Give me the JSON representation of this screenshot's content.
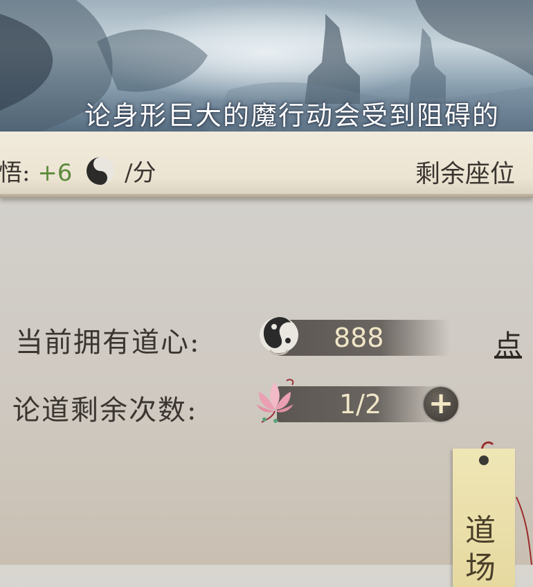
{
  "banner": {
    "text": "论身形巨大的魔行动会受到阻碍的"
  },
  "info_bar": {
    "gain_label": "悟: ",
    "gain_value": "+6",
    "gain_unit": "/分",
    "seats_label": "剩余座位"
  },
  "resources": {
    "daoxin_label": "当前拥有道心:",
    "daoxin_value": "888",
    "link_label": "点",
    "attempts_label": "论道剩余次数:",
    "attempts_value": "1/2",
    "add_label": "+"
  },
  "tag": {
    "text": "道场"
  },
  "icons": {
    "daoxin": "yin-yang-fish-icon",
    "attempts": "lotus-icon",
    "add": "plus-icon"
  },
  "colors": {
    "gain_green": "#5d8a3e",
    "value_text": "#f0e6c8",
    "tag_paper": "#ece0a8"
  }
}
